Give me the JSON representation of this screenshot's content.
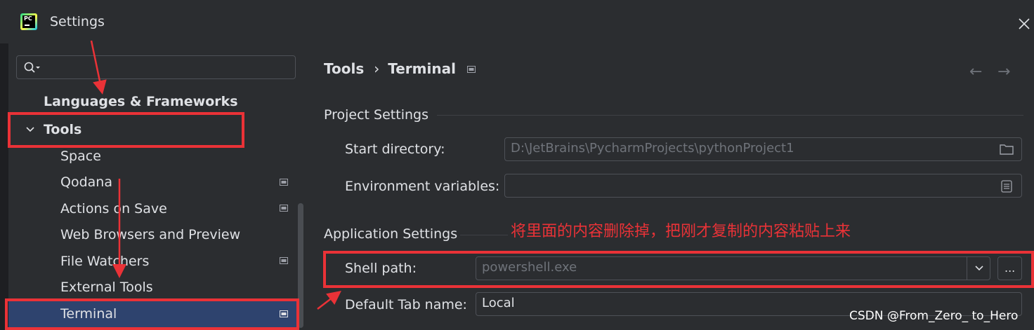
{
  "window": {
    "title": "Settings",
    "app_icon": "pycharm-logo",
    "logo_text": "PC",
    "close_icon": "close-icon"
  },
  "search": {
    "value": "",
    "icon": "search-icon"
  },
  "sidebar": {
    "items": [
      {
        "label": "Languages & Frameworks",
        "bold": true
      },
      {
        "label": "Tools",
        "bold": true,
        "expanded": true
      },
      {
        "label": "Space"
      },
      {
        "label": "Qodana",
        "has_project_icon": true
      },
      {
        "label": "Actions on Save",
        "has_project_icon": true
      },
      {
        "label": "Web Browsers and Preview"
      },
      {
        "label": "File Watchers",
        "has_project_icon": true
      },
      {
        "label": "External Tools"
      },
      {
        "label": "Terminal",
        "selected": true,
        "has_project_icon": true
      }
    ]
  },
  "breadcrumb": {
    "parent": "Tools",
    "separator": "›",
    "current": "Terminal"
  },
  "nav": {
    "back": "←",
    "forward": "→"
  },
  "project_settings": {
    "title": "Project Settings",
    "start_directory": {
      "label": "Start directory:",
      "value": "D:\\JetBrains\\PycharmProjects\\pythonProject1",
      "icon": "folder-icon"
    },
    "environment_variables": {
      "label": "Environment variables:",
      "value": "",
      "icon": "list-icon"
    }
  },
  "application_settings": {
    "title": "Application Settings",
    "shell_path": {
      "label": "Shell path:",
      "value": "powershell.exe",
      "dropdown_icon": "chevron-down-icon",
      "browse_label": "..."
    },
    "default_tab_name": {
      "label": "Default Tab name:",
      "value": "Local"
    }
  },
  "annotation": {
    "text": "将里面的内容删除掉，把刚才复制的内容粘贴上来",
    "color": "#ea3237"
  },
  "watermark": "CSDN @From_Zero_ to_Hero",
  "colors": {
    "accent_red": "#ea3237",
    "selection": "#2e436e",
    "background": "#2b2d30"
  }
}
